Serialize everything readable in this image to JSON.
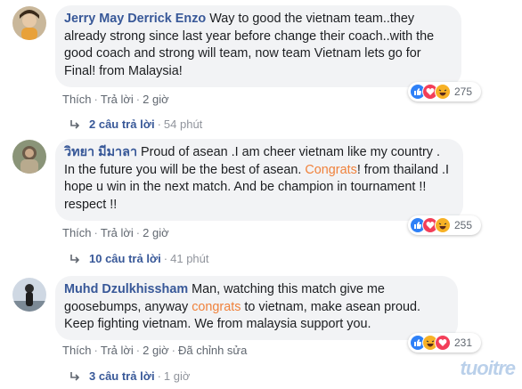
{
  "comments": [
    {
      "author": "Jerry May Derrick Enzo",
      "text": "Way to good the vietnam team..they already strong since last year before change their coach..with the good coach and strong will team, now team Vietnam lets go for Final! from Malaysia!",
      "like_label": "Thích",
      "reply_label": "Trả lời",
      "time": "2 giờ",
      "reaction_count": "275",
      "replies_label": "2 câu trả lời",
      "replies_time": "54 phút",
      "reaction_icons": [
        "like-icon",
        "love-icon",
        "haha-icon"
      ]
    },
    {
      "author": "วิทยา มีมาลา",
      "text_before": "Proud of asean .I am cheer vietnam like my country . In the future you will be the best of asean. ",
      "text_highlight": "Congrats",
      "text_after": "! from thailand .I hope u win in the next match. And be champion in tournament !! respect !!",
      "like_label": "Thích",
      "reply_label": "Trả lời",
      "time": "2 giờ",
      "reaction_count": "255",
      "replies_label": "10 câu trả lời",
      "replies_time": "41 phút",
      "reaction_icons": [
        "like-icon",
        "love-icon",
        "haha-icon"
      ]
    },
    {
      "author": "Muhd Dzulkhissham",
      "text_before": "Man, watching this match give me goosebumps, anyway ",
      "text_highlight": "congrats",
      "text_after": " to vietnam, make asean proud. Keep fighting vietnam. We from malaysia support you.",
      "like_label": "Thích",
      "reply_label": "Trả lời",
      "time": "2 giờ",
      "edited_label": "Đã chỉnh sửa",
      "reaction_count": "231",
      "replies_label": "3 câu trả lời",
      "replies_time": "1 giờ",
      "reaction_icons": [
        "like-icon",
        "haha-icon",
        "love-icon"
      ]
    }
  ],
  "watermark": "tuoitre",
  "colors": {
    "author": "#385898",
    "highlight": "#f0823c",
    "bubble": "#f2f3f5",
    "like": "#2e80f7",
    "love": "#f33e58",
    "haha": "#f7b125"
  }
}
